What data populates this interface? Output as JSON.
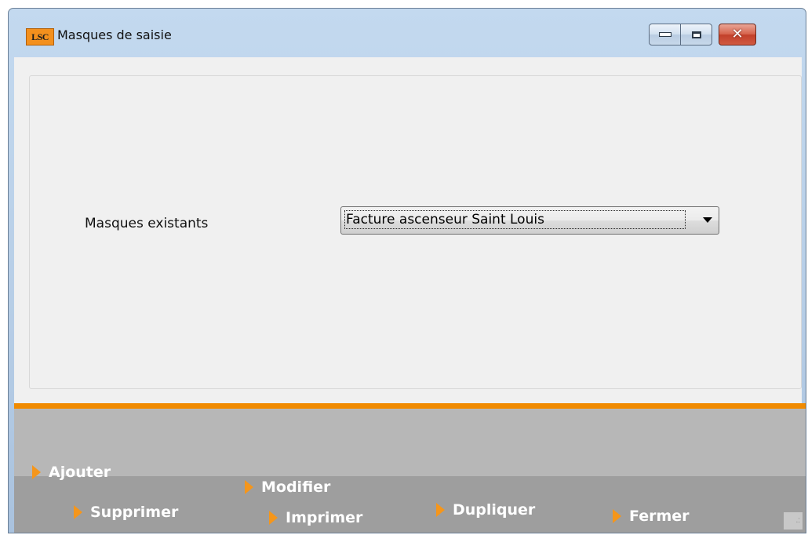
{
  "window": {
    "title": "Masques de saisie",
    "app_icon_text": "LSC",
    "controls": {
      "minimize": "minimize-icon",
      "maximize": "maximize-icon",
      "close": "close-icon"
    }
  },
  "form": {
    "label": "Masques existants",
    "select_value": "Facture ascenseur Saint Louis"
  },
  "toolbar": {
    "ajouter": "Ajouter",
    "modifier": "Modifier",
    "supprimer": "Supprimer",
    "imprimer": "Imprimer",
    "dupliquer": "Dupliquer",
    "fermer": "Fermer"
  },
  "colors": {
    "accent": "#f08a00",
    "toolbar_bg": "#b7b7b7",
    "toolbar_band": "#9e9e9e",
    "client_bg": "#f0f0f0"
  }
}
